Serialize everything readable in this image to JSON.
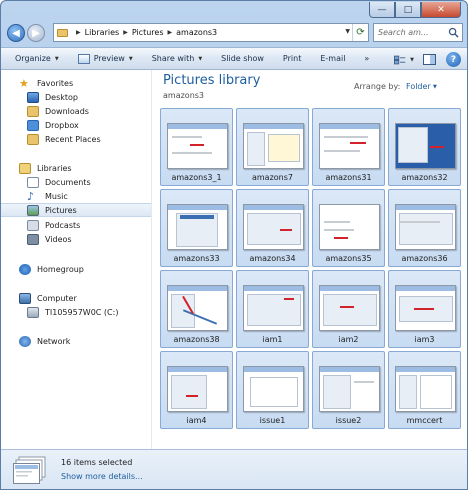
{
  "window": {
    "controls": {
      "minimize": "—",
      "maximize": "□",
      "close": "✕"
    }
  },
  "nav": {
    "breadcrumb": [
      "Libraries",
      "Pictures",
      "amazons3"
    ],
    "search_placeholder": "Search am..."
  },
  "toolbar": {
    "organize": "Organize",
    "preview": "Preview",
    "share_with": "Share with",
    "slide_show": "Slide show",
    "print": "Print",
    "email": "E-mail",
    "more": "»"
  },
  "sidebar": {
    "favorites": "Favorites",
    "favorites_items": [
      "Desktop",
      "Downloads",
      "Dropbox",
      "Recent Places"
    ],
    "libraries": "Libraries",
    "libraries_items": [
      "Documents",
      "Music",
      "Pictures",
      "Podcasts",
      "Videos"
    ],
    "homegroup": "Homegroup",
    "computer": "Computer",
    "computer_items": [
      "TI105957W0C (C:)"
    ],
    "network": "Network",
    "selected": "Pictures"
  },
  "main": {
    "title": "Pictures library",
    "subtitle": "amazons3",
    "arrange_label": "Arrange by:",
    "arrange_value": "Folder"
  },
  "files": [
    "amazons3_1",
    "amazons7",
    "amazons31",
    "amazons32",
    "amazons33",
    "amazons34",
    "amazons35",
    "amazons36",
    "amazons38",
    "iam1",
    "iam2",
    "iam3",
    "iam4",
    "issue1",
    "issue2",
    "mmccert"
  ],
  "details": {
    "count": "16 items selected",
    "more": "Show more details..."
  },
  "colors": {
    "accent": "#1e5e9e",
    "tile_fill": "#c7dbf2",
    "tile_border": "#87a9d4"
  }
}
